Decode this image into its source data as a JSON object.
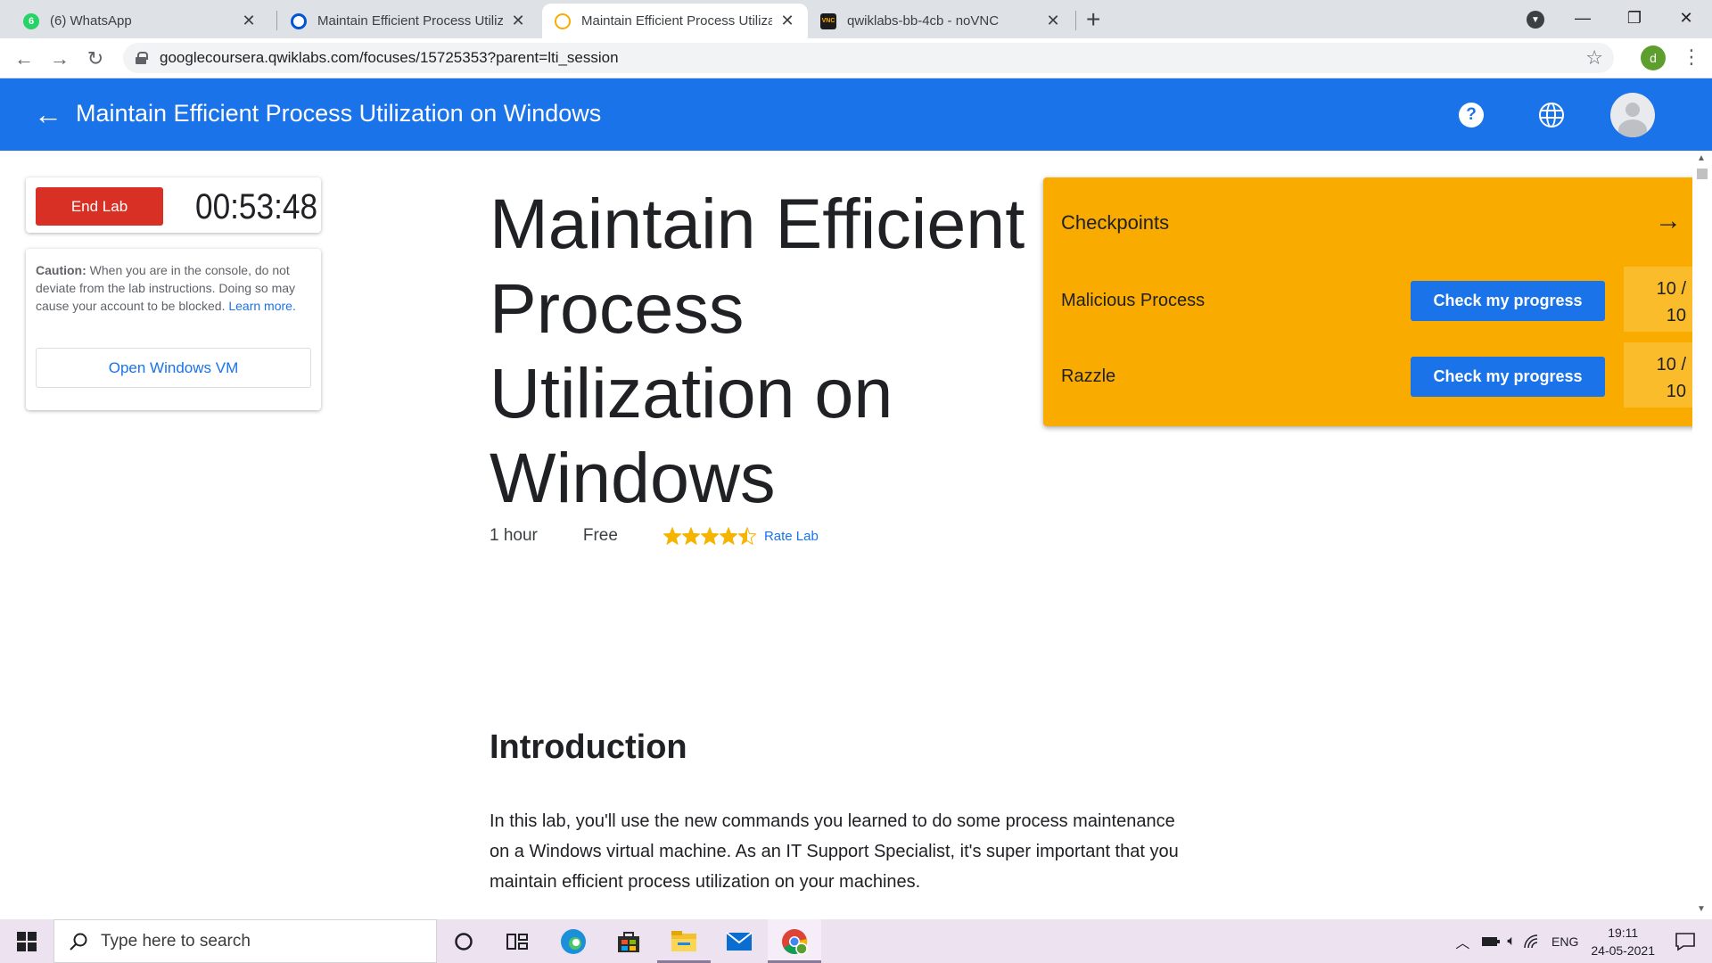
{
  "browser": {
    "tabs": [
      {
        "title": "(6) WhatsApp",
        "icon": "whatsapp-icon",
        "badge": "6",
        "active": false
      },
      {
        "title": "Maintain Efficient Process Utilizat",
        "icon": "coursera-icon",
        "active": false
      },
      {
        "title": "Maintain Efficient Process Utilizat",
        "icon": "qwiklabs-icon",
        "active": true
      },
      {
        "title": "qwiklabs-bb-4cb - noVNC",
        "icon": "vnc-icon",
        "active": false
      }
    ],
    "url": "googlecoursera.qwiklabs.com/focuses/15725353?parent=lti_session",
    "profile_initial": "d"
  },
  "header": {
    "title": "Maintain Efficient Process Utilization on Windows"
  },
  "lab_controls": {
    "end_lab_label": "End Lab",
    "timer": "00:53:48",
    "caution_bold": "Caution:",
    "caution_text": " When you are in the console, do not deviate from the lab instructions. Doing so may cause your account to be blocked. ",
    "learn_more": "Learn more.",
    "open_vm_label": "Open Windows VM"
  },
  "lab": {
    "title": "Maintain Efficient Process Utilization on Windows",
    "duration": "1 hour",
    "price": "Free",
    "rating": 4.5,
    "rate_label": "Rate Lab"
  },
  "checkpoints": {
    "title": "Checkpoints",
    "items": [
      {
        "label": "Malicious Process",
        "button": "Check my progress",
        "score_line1": "10 /",
        "score_line2": "10"
      },
      {
        "label": "Razzle",
        "button": "Check my progress",
        "score_line1": "10 /",
        "score_line2": "10"
      }
    ]
  },
  "introduction": {
    "heading": "Introduction",
    "body": "In this lab, you'll use the new commands you learned to do some process maintenance on a Windows virtual machine. As an IT Support Specialist, it's super important that you maintain efficient process utilization on your machines."
  },
  "taskbar": {
    "search_placeholder": "Type here to search",
    "language": "ENG",
    "time": "19:11",
    "date": "24-05-2021"
  },
  "colors": {
    "header_blue": "#1a73e8",
    "end_lab_red": "#d93025",
    "checkpoint_yellow": "#f9ab00",
    "star_gold": "#f4b400"
  }
}
